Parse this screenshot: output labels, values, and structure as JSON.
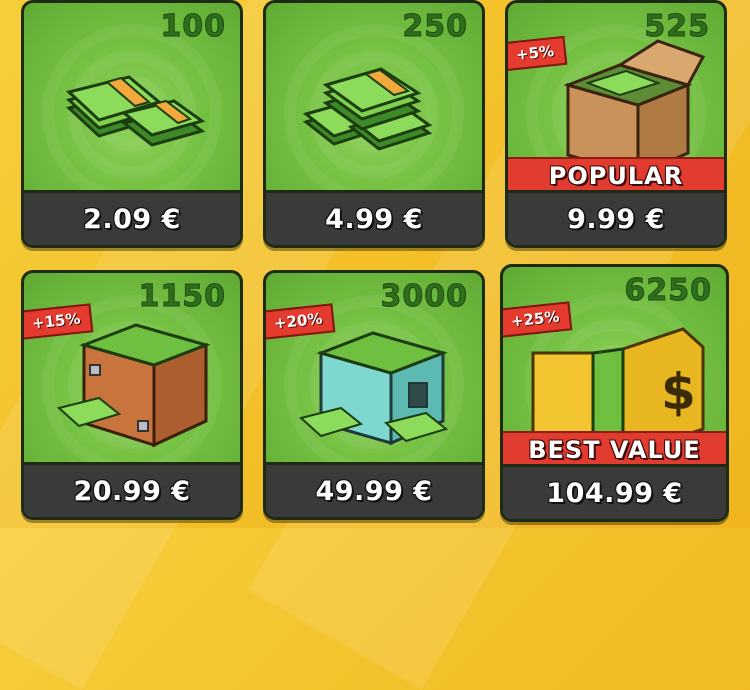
{
  "shop": {
    "items": [
      {
        "amount": "100",
        "price": "2.09 €"
      },
      {
        "amount": "250",
        "price": "4.99 €"
      },
      {
        "amount": "525",
        "price": "9.99 €",
        "bonus": "+5%",
        "tag": "POPULAR"
      },
      {
        "amount": "1150",
        "price": "20.99 €",
        "bonus": "+15%"
      },
      {
        "amount": "3000",
        "price": "49.99 €",
        "bonus": "+20%"
      },
      {
        "amount": "6250",
        "price": "104.99 €",
        "bonus": "+25%",
        "tag": "BEST VALUE"
      }
    ]
  },
  "icons": {
    "item_0": "small-cash-stacks-icon",
    "item_1": "cash-pile-icon",
    "item_2": "cardboard-box-cash-icon",
    "item_3": "wooden-crate-cash-icon",
    "item_4": "metal-crate-cash-icon",
    "item_5": "gold-safe-cash-icon"
  },
  "colors": {
    "card_green": "#74c042",
    "price_bar": "#3a3a3a",
    "ribbon_red": "#e23b30",
    "amount_text": "#2e6e1c"
  }
}
